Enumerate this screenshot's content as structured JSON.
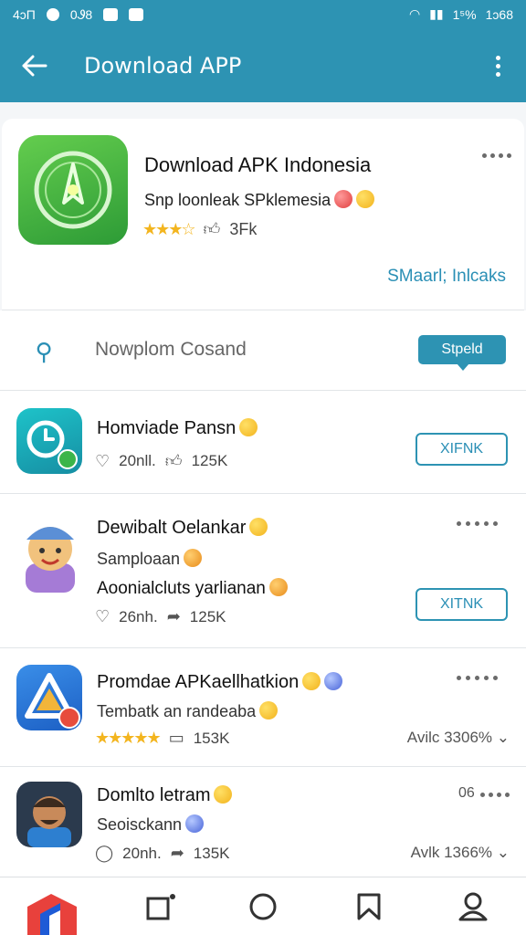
{
  "status_bar": {
    "left_time": "4ɔП",
    "left_text": "0Ꮽ8",
    "right_battery": "1⁵%",
    "right_time": "1ɔ68"
  },
  "app_bar": {
    "title": "Download APP"
  },
  "featured": {
    "title": "Download APK Indonesia",
    "subtitle": "Snp loonleak SPklemesia",
    "rating_stars": "★★★☆",
    "count": "3Fk",
    "link": "SMaarl; Inlcaks"
  },
  "search": {
    "placeholder": "Nowplom Cosand",
    "button": "Stpeld"
  },
  "apps": [
    {
      "name": "Homviade Pansn",
      "likes": "20nll.",
      "downloads": "125K",
      "action": "XIFNK"
    },
    {
      "name": "Dewibalt Oelankar",
      "desc1": "Samploaan",
      "desc2": "Aoonialcluts yarlianan",
      "likes": "26nh.",
      "downloads": "125K",
      "action": "XITNK"
    },
    {
      "name": "Promdae APKaellhatkion",
      "desc": "Tembatk an randeaba",
      "rating_stars": "★★★★★",
      "downloads": "153K",
      "availability": "Avilc 3306% ⌄"
    },
    {
      "name": "Domlto letram",
      "desc": "Seoisckann",
      "likes": "20nh.",
      "downloads": "135K",
      "availability": "Avlk 1366% ⌄",
      "menu_prefix": "06"
    }
  ],
  "colors": {
    "primary": "#2d93b3",
    "accent_link": "#2a8fb5",
    "star": "#f3b51f"
  }
}
